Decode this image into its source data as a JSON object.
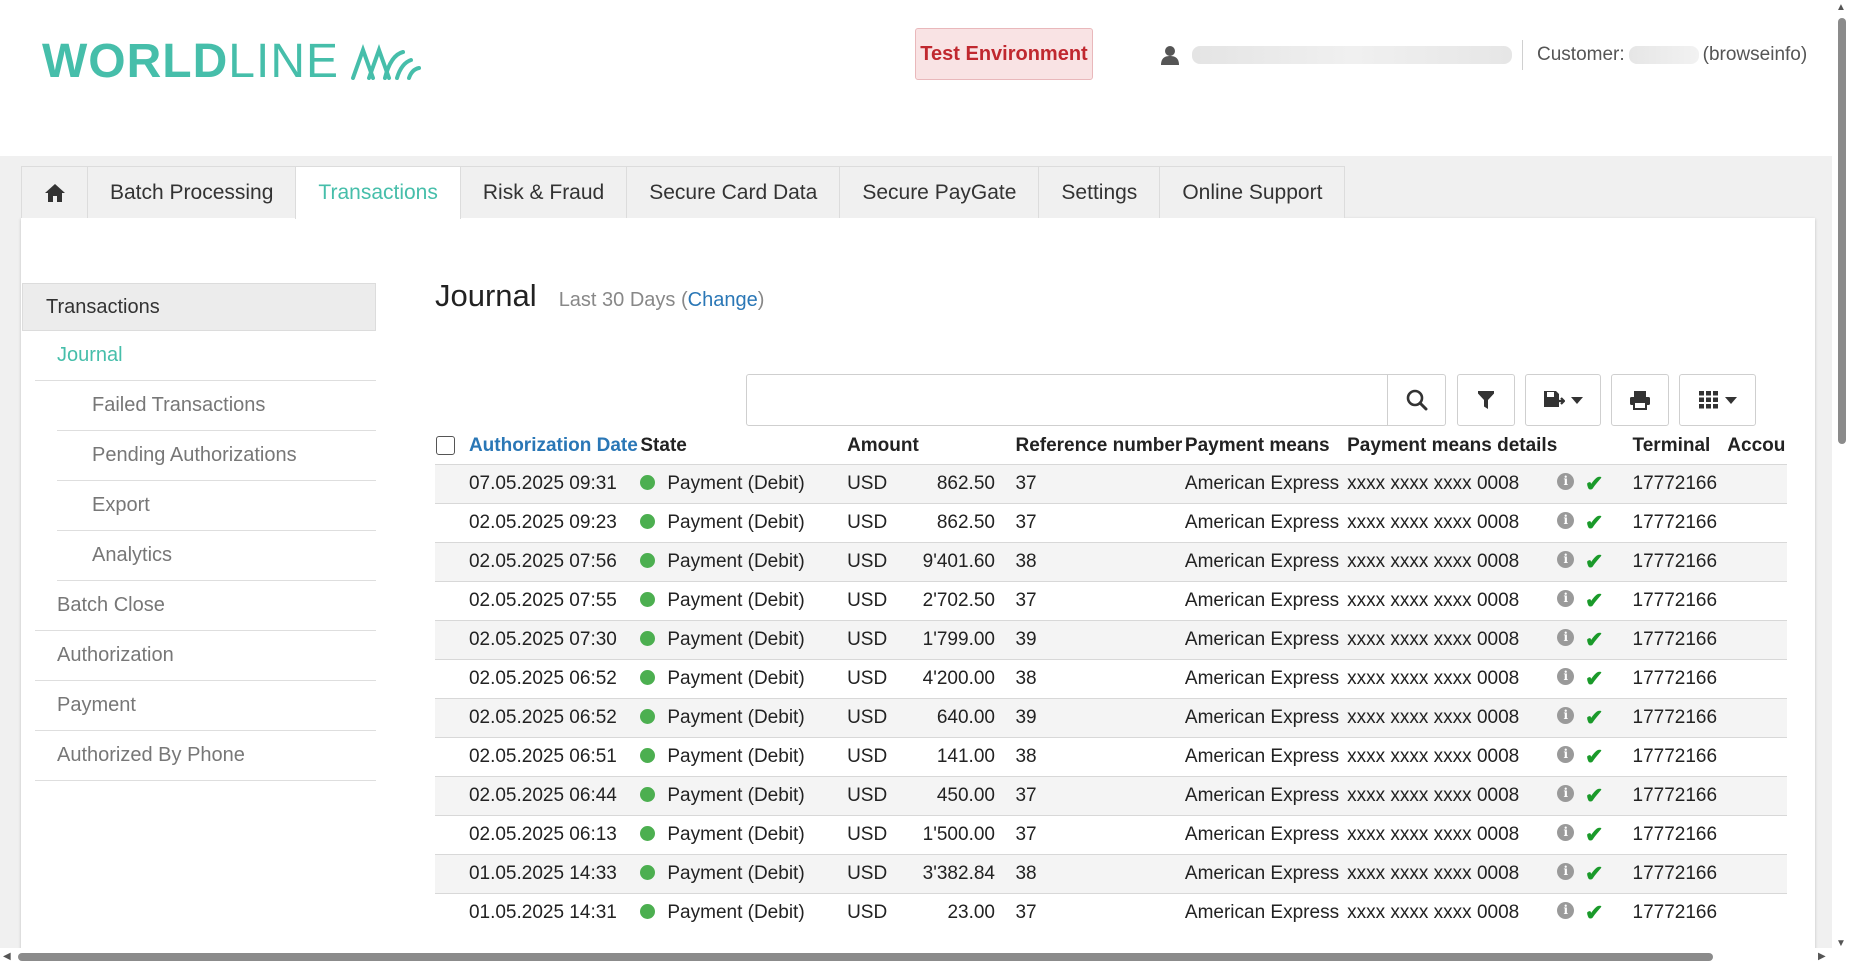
{
  "brand": {
    "logo_bold": "WORLD",
    "logo_light": "LINE",
    "accent": "#46beaa"
  },
  "header": {
    "environment_badge": "Test Environment",
    "customer_label": "Customer:",
    "customer_suffix": "(browseinfo)"
  },
  "nav": {
    "home_icon": "home-icon",
    "tabs": [
      "Batch Processing",
      "Transactions",
      "Risk & Fraud",
      "Secure Card Data",
      "Secure PayGate",
      "Settings",
      "Online Support"
    ],
    "active_tab": "Transactions"
  },
  "sidebar": {
    "header": "Transactions",
    "items": [
      "Journal",
      "Failed Transactions",
      "Pending Authorizations",
      "Export",
      "Analytics",
      "Batch Close",
      "Authorization",
      "Payment",
      "Authorized By Phone"
    ],
    "active_item": "Journal"
  },
  "journal": {
    "title": "Journal",
    "period": "Last 30 Days (",
    "change_link": "Change",
    "period_close": ")",
    "search_value": ""
  },
  "table": {
    "columns": [
      "Authorization Date",
      "State",
      "Amount",
      "Reference number",
      "Payment means",
      "Payment means details",
      "Terminal",
      "Accou"
    ],
    "sorted_column": "Authorization Date",
    "rows": [
      {
        "date": "07.05.2025 09:31",
        "state": "Payment (Debit)",
        "currency": "USD",
        "amount": "862.50",
        "reference": "37",
        "means": "American Express",
        "details": "xxxx xxxx xxxx 0008",
        "terminal": "17772166"
      },
      {
        "date": "02.05.2025 09:23",
        "state": "Payment (Debit)",
        "currency": "USD",
        "amount": "862.50",
        "reference": "37",
        "means": "American Express",
        "details": "xxxx xxxx xxxx 0008",
        "terminal": "17772166"
      },
      {
        "date": "02.05.2025 07:56",
        "state": "Payment (Debit)",
        "currency": "USD",
        "amount": "9'401.60",
        "reference": "38",
        "means": "American Express",
        "details": "xxxx xxxx xxxx 0008",
        "terminal": "17772166"
      },
      {
        "date": "02.05.2025 07:55",
        "state": "Payment (Debit)",
        "currency": "USD",
        "amount": "2'702.50",
        "reference": "37",
        "means": "American Express",
        "details": "xxxx xxxx xxxx 0008",
        "terminal": "17772166"
      },
      {
        "date": "02.05.2025 07:30",
        "state": "Payment (Debit)",
        "currency": "USD",
        "amount": "1'799.00",
        "reference": "39",
        "means": "American Express",
        "details": "xxxx xxxx xxxx 0008",
        "terminal": "17772166"
      },
      {
        "date": "02.05.2025 06:52",
        "state": "Payment (Debit)",
        "currency": "USD",
        "amount": "4'200.00",
        "reference": "38",
        "means": "American Express",
        "details": "xxxx xxxx xxxx 0008",
        "terminal": "17772166"
      },
      {
        "date": "02.05.2025 06:52",
        "state": "Payment (Debit)",
        "currency": "USD",
        "amount": "640.00",
        "reference": "39",
        "means": "American Express",
        "details": "xxxx xxxx xxxx 0008",
        "terminal": "17772166"
      },
      {
        "date": "02.05.2025 06:51",
        "state": "Payment (Debit)",
        "currency": "USD",
        "amount": "141.00",
        "reference": "38",
        "means": "American Express",
        "details": "xxxx xxxx xxxx 0008",
        "terminal": "17772166"
      },
      {
        "date": "02.05.2025 06:44",
        "state": "Payment (Debit)",
        "currency": "USD",
        "amount": "450.00",
        "reference": "37",
        "means": "American Express",
        "details": "xxxx xxxx xxxx 0008",
        "terminal": "17772166"
      },
      {
        "date": "02.05.2025 06:13",
        "state": "Payment (Debit)",
        "currency": "USD",
        "amount": "1'500.00",
        "reference": "37",
        "means": "American Express",
        "details": "xxxx xxxx xxxx 0008",
        "terminal": "17772166"
      },
      {
        "date": "01.05.2025 14:33",
        "state": "Payment (Debit)",
        "currency": "USD",
        "amount": "3'382.84",
        "reference": "38",
        "means": "American Express",
        "details": "xxxx xxxx xxxx 0008",
        "terminal": "17772166"
      },
      {
        "date": "01.05.2025 14:31",
        "state": "Payment (Debit)",
        "currency": "USD",
        "amount": "23.00",
        "reference": "37",
        "means": "American Express",
        "details": "xxxx xxxx xxxx 0008",
        "terminal": "17772166"
      }
    ]
  },
  "colors": {
    "state_ok": "#4caf50",
    "link": "#2a77b6",
    "badge_text": "#c0282f",
    "check": "#1a9a2a"
  }
}
